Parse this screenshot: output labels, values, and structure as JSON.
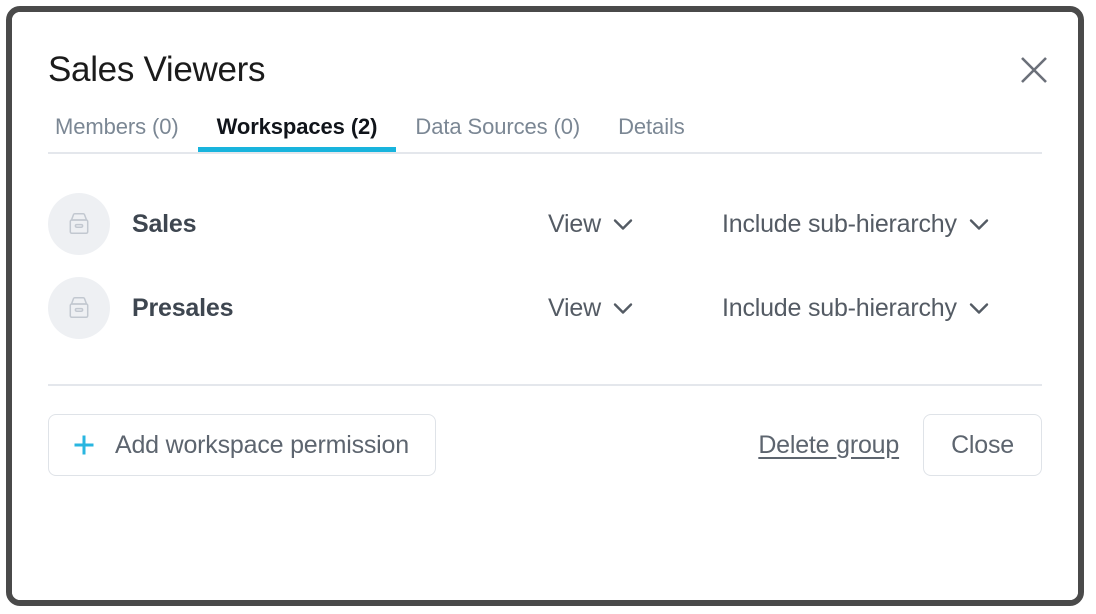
{
  "modal": {
    "title": "Sales Viewers",
    "close_icon": "close-icon"
  },
  "tabs": [
    {
      "label": "Members (0)",
      "active": false
    },
    {
      "label": "Workspaces (2)",
      "active": true
    },
    {
      "label": "Data Sources (0)",
      "active": false
    },
    {
      "label": "Details",
      "active": false
    }
  ],
  "rows": [
    {
      "icon": "archive-box-icon",
      "name": "Sales",
      "permission": "View",
      "scope": "Include sub-hierarchy"
    },
    {
      "icon": "archive-box-icon",
      "name": "Presales",
      "permission": "View",
      "scope": "Include sub-hierarchy"
    }
  ],
  "footer": {
    "add_label": "Add workspace permission",
    "add_icon": "plus-icon",
    "delete_label": "Delete group",
    "close_label": "Close"
  },
  "colors": {
    "accent": "#18b4dd",
    "frame": "#4a4a4a",
    "divider": "#e4e7ec",
    "text_muted": "#7b8794",
    "text_strong": "#10141a"
  }
}
